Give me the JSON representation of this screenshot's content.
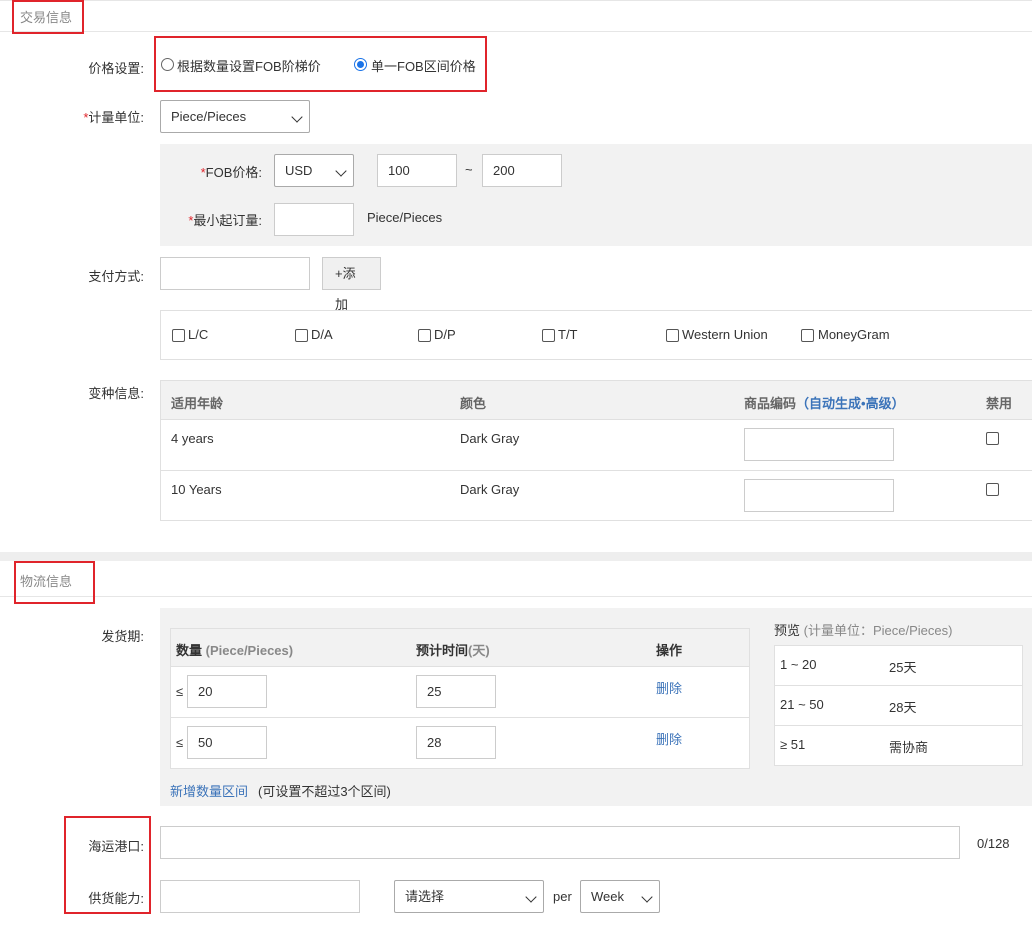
{
  "trade": {
    "section_title": "交易信息",
    "price_setting": {
      "label": "价格设置:",
      "options": [
        "根据数量设置FOB阶梯价",
        "单一FOB区间价格"
      ],
      "selected_index": 1
    },
    "unit": {
      "label": "计量单位:",
      "value": "Piece/Pieces"
    },
    "fob": {
      "label": "FOB价格:",
      "currency": "USD",
      "min": "100",
      "tilde": "~",
      "max": "200"
    },
    "moq": {
      "label": "最小起订量:",
      "value": "",
      "unit": "Piece/Pieces"
    },
    "payment": {
      "label": "支付方式:",
      "add_button": "+添加",
      "methods": [
        "L/C",
        "D/A",
        "D/P",
        "T/T",
        "Western Union",
        "MoneyGram"
      ]
    },
    "variants": {
      "label": "变种信息:",
      "headers": {
        "age": "适用年龄",
        "color": "颜色",
        "code": "商品编码",
        "code_paren_open": "（",
        "auto": "自动生成",
        "dot": "•",
        "advanced": "高级",
        "code_paren_close": "）",
        "disable": "禁用"
      },
      "rows": [
        {
          "age": "4 years",
          "color": "Dark Gray",
          "code": ""
        },
        {
          "age": "10 Years",
          "color": "Dark Gray",
          "code": ""
        }
      ]
    }
  },
  "logistics": {
    "section_title": "物流信息",
    "delivery": {
      "label": "发货期:",
      "headers": {
        "qty": "数量",
        "qty_unit": "(Piece/Pieces)",
        "time": "预计时间",
        "time_unit": "(天)",
        "op": "操作"
      },
      "rows": [
        {
          "le": "≤",
          "qty": "20",
          "days": "25",
          "delete": "删除"
        },
        {
          "le": "≤",
          "qty": "50",
          "days": "28",
          "delete": "删除"
        }
      ],
      "add_link": "新增数量区间",
      "add_note": "(可设置不超过3个区间)",
      "preview": {
        "title": "预览",
        "title_note": "(计量单位：Piece/Pieces)",
        "rows": [
          {
            "range": "1 ~ 20",
            "days": "25天"
          },
          {
            "range": "21 ~ 50",
            "days": "28天"
          },
          {
            "range": "≥ 51",
            "days": "需协商"
          }
        ]
      }
    },
    "port": {
      "label": "海运港口:",
      "value": "",
      "counter": "0/128"
    },
    "supply": {
      "label": "供货能力:",
      "value": "",
      "select_placeholder": "请选择",
      "per": "per",
      "period": "Week"
    }
  },
  "colors": {
    "highlight": "#e0242b",
    "link": "#3b73b9",
    "radio": "#1a73e8"
  }
}
